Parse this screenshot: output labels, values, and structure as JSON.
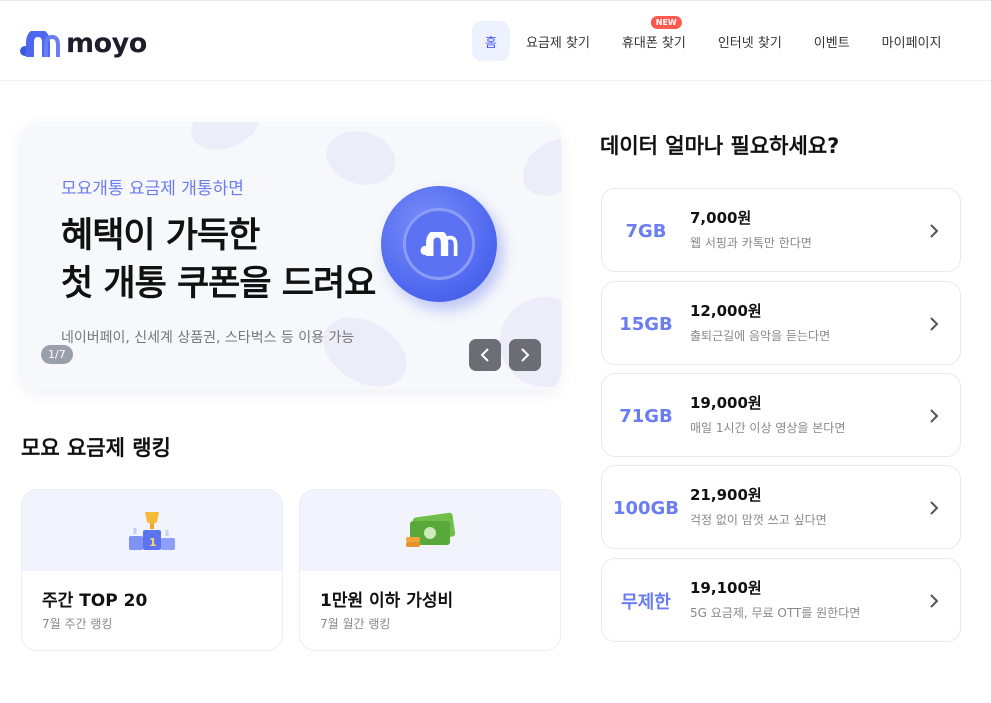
{
  "header": {
    "logo_text": "moyo",
    "nav": [
      {
        "label": "홈",
        "active": true
      },
      {
        "label": "요금제 찾기"
      },
      {
        "label": "휴대폰 찾기",
        "badge": "NEW"
      },
      {
        "label": "인터넷 찾기"
      },
      {
        "label": "이벤트"
      },
      {
        "label": "마이페이지"
      }
    ]
  },
  "banner": {
    "subtitle": "모요개통 요금제 개통하면",
    "title_line1": "혜택이 가득한",
    "title_line2": "첫 개통 쿠폰을 드려요",
    "description": "네이버페이, 신세계 상품권, 스타벅스 등 이용 가능",
    "counter": "1/7",
    "prev_icon": "chevron-left-icon",
    "next_icon": "chevron-right-icon"
  },
  "ranking": {
    "title": "모요 요금제 랭킹",
    "cards": [
      {
        "name": "주간 TOP 20",
        "sub": "7월 주간 랭킹",
        "icon": "trophy-podium-icon"
      },
      {
        "name": "1만원 이하 가성비",
        "sub": "7월 월간 랭킹",
        "icon": "money-icon"
      }
    ]
  },
  "data_section": {
    "title": "데이터 얼마나 필요하세요?",
    "plans": [
      {
        "gb": "7GB",
        "price": "7,000원",
        "desc": "웹 서핑과 카톡만 한다면"
      },
      {
        "gb": "15GB",
        "price": "12,000원",
        "desc": "출퇴근길에 음악을 듣는다면"
      },
      {
        "gb": "71GB",
        "price": "19,000원",
        "desc": "매일 1시간 이상 영상을 본다면"
      },
      {
        "gb": "100GB",
        "price": "21,900원",
        "desc": "걱정 없이 맘껏 쓰고 싶다면"
      },
      {
        "gb": "무제한",
        "price": "19,100원",
        "desc": "5G 요금제, 무료 OTT를 원한다면"
      }
    ]
  },
  "colors": {
    "accent": "#6a7df2",
    "brand": "#4e67ef",
    "badge": "#ff5a4d"
  }
}
